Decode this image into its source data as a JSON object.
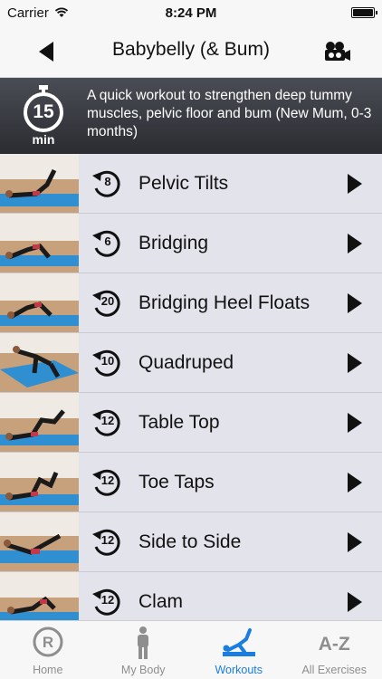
{
  "status": {
    "carrier": "Carrier",
    "time": "8:24 PM"
  },
  "nav": {
    "title": "Babybelly (& Bum)"
  },
  "banner": {
    "duration": "15",
    "unit": "min",
    "description": "A quick workout to strengthen deep tummy muscles, pelvic floor and bum (New Mum, 0-3 months)"
  },
  "exercises": [
    {
      "reps": "8",
      "name": "Pelvic Tilts"
    },
    {
      "reps": "6",
      "name": "Bridging"
    },
    {
      "reps": "20",
      "name": "Bridging Heel Floats"
    },
    {
      "reps": "10",
      "name": "Quadruped"
    },
    {
      "reps": "12",
      "name": "Table Top"
    },
    {
      "reps": "12",
      "name": "Toe Taps"
    },
    {
      "reps": "12",
      "name": "Side to Side"
    },
    {
      "reps": "12",
      "name": "Clam"
    }
  ],
  "tabs": [
    {
      "label": "Home",
      "icon": "r-logo-icon"
    },
    {
      "label": "My Body",
      "icon": "person-icon"
    },
    {
      "label": "Workouts",
      "icon": "workout-pose-icon"
    },
    {
      "label": "All Exercises",
      "icon": "a-z-icon",
      "glyph": "A-Z"
    }
  ],
  "colors": {
    "accent": "#1a7de0",
    "banner": "#3a3c42",
    "row": "#e3e3ec"
  }
}
